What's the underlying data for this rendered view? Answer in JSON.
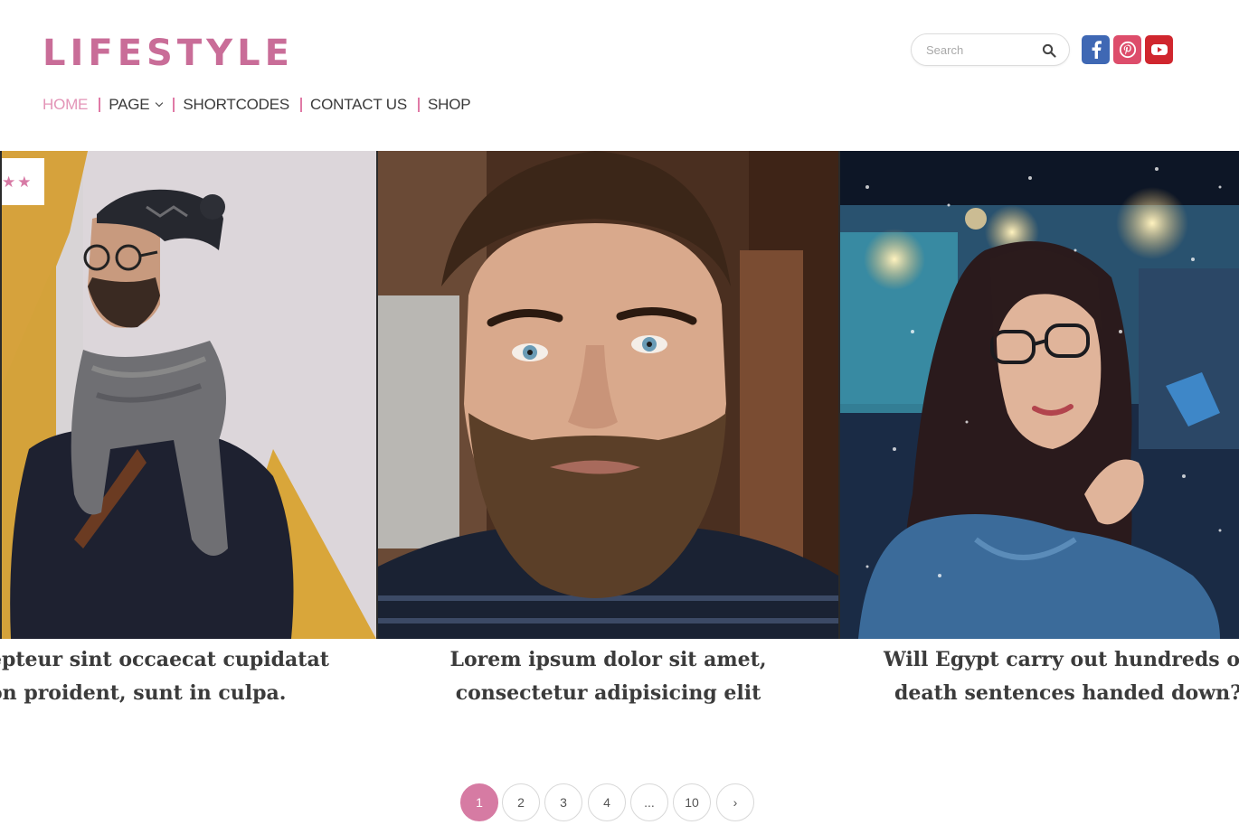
{
  "header": {
    "logo": "LIFESTYLE",
    "nav": [
      {
        "label": "HOME",
        "active": true
      },
      {
        "label": "PAGE",
        "has_dropdown": true
      },
      {
        "label": "SHORTCODES"
      },
      {
        "label": "CONTACT US"
      },
      {
        "label": "SHOP"
      }
    ],
    "search": {
      "placeholder": "Search",
      "icon": "search-icon"
    },
    "social": [
      {
        "name": "facebook-icon",
        "color": "#3f68b4"
      },
      {
        "name": "pinterest-icon",
        "color": "#dd4d6b"
      },
      {
        "name": "youtube-icon",
        "color": "#d0262e"
      }
    ]
  },
  "slider": {
    "rating_badge": "★★",
    "slides": [
      {
        "image": "man-in-beanie-and-scarf",
        "caption_lines": [
          "epteur sint occaecat cupidatat",
          "on proident, sunt in culpa."
        ]
      },
      {
        "image": "bearded-man-portrait",
        "caption_lines": [
          "Lorem ipsum dolor sit amet,",
          "consectetur adipisicing elit"
        ]
      },
      {
        "image": "woman-with-glasses-in-snow",
        "caption_lines": [
          "Will Egypt carry out hundreds o",
          "death sentences handed down?"
        ]
      }
    ]
  },
  "pagination": {
    "pages": [
      "1",
      "2",
      "3",
      "4",
      "...",
      "10",
      "›"
    ],
    "current": "1"
  },
  "colors": {
    "accent": "#c96d98",
    "nav_active": "#e394b7"
  }
}
